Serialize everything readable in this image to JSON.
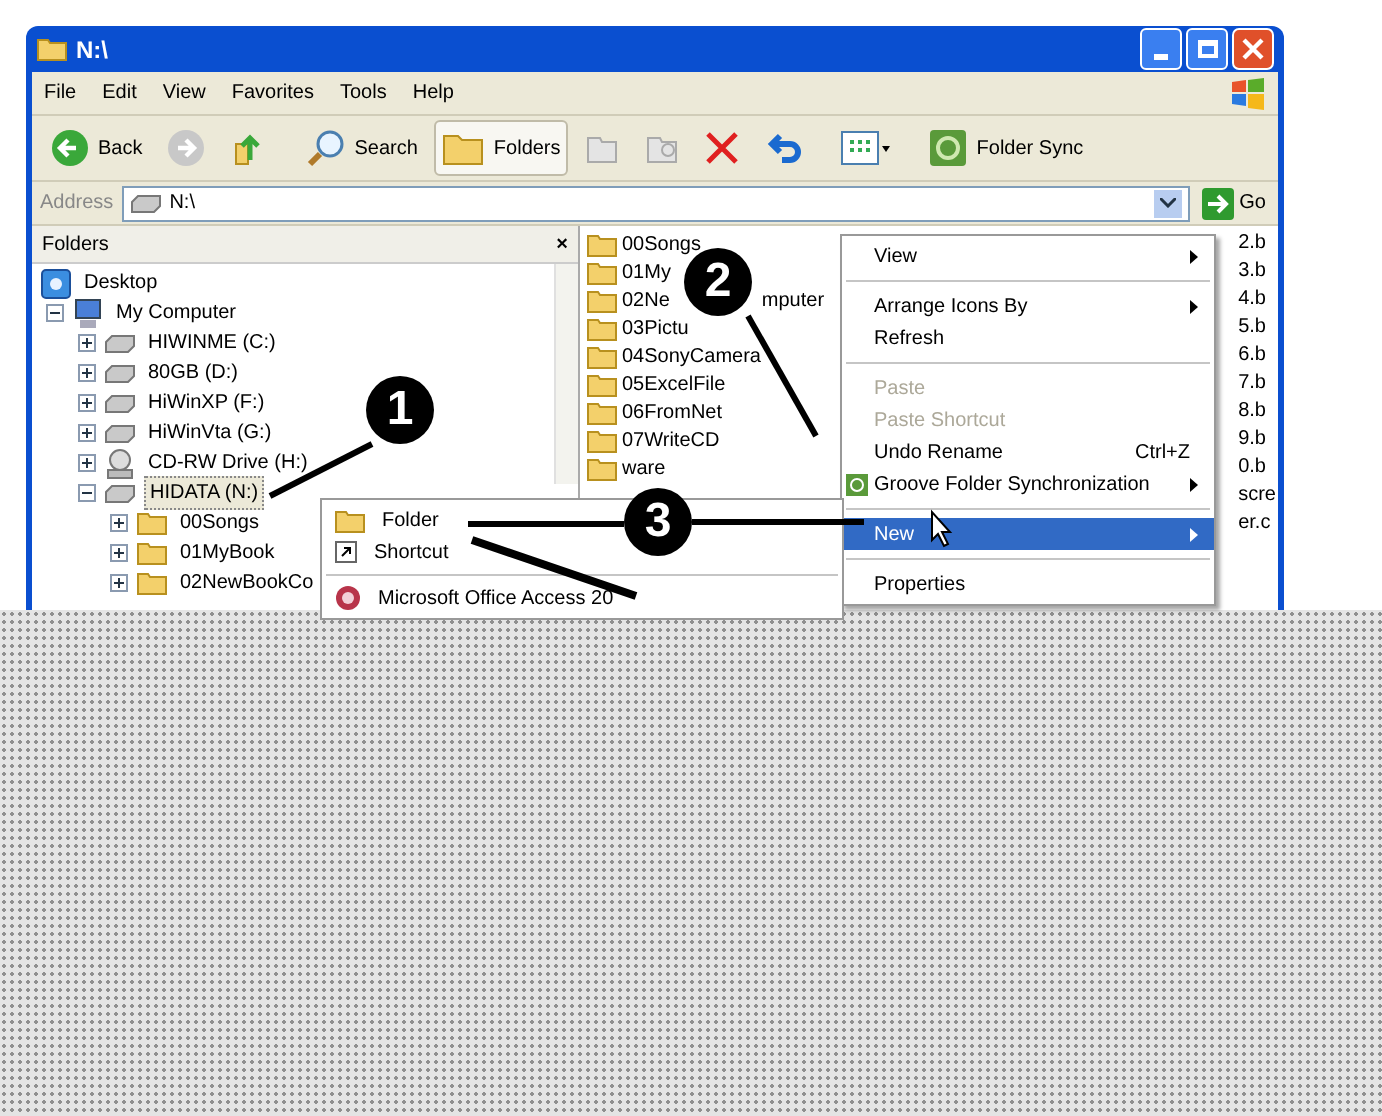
{
  "window": {
    "title": "N:\\"
  },
  "menu_bar": [
    "File",
    "Edit",
    "View",
    "Favorites",
    "Tools",
    "Help"
  ],
  "toolbar": [
    {
      "kind": "back",
      "label": "Back",
      "pressed": false
    },
    {
      "kind": "forward",
      "pressed": false
    },
    {
      "kind": "up",
      "pressed": false
    },
    {
      "kind": "search",
      "label": "Search",
      "pressed": false
    },
    {
      "kind": "folders",
      "label": "Folders",
      "pressed": true
    },
    {
      "kind": "move",
      "pressed": false
    },
    {
      "kind": "copy",
      "pressed": false
    },
    {
      "kind": "delete",
      "pressed": false
    },
    {
      "kind": "undo",
      "pressed": false
    },
    {
      "kind": "views",
      "pressed": false
    },
    {
      "kind": "sync",
      "label": "Folder Sync",
      "pressed": false
    }
  ],
  "address": {
    "label": "Address",
    "value": "N:\\",
    "go": "Go"
  },
  "folders_pane": {
    "title": "Folders",
    "close": "×",
    "tree": [
      {
        "kind": "desktop",
        "label": "Desktop",
        "selected": false,
        "children": [
          {
            "kind": "computer",
            "label": "My Computer",
            "expanded": true,
            "selected": false,
            "children": [
              {
                "kind": "drive",
                "label": "HIWINME (C:)",
                "expanded": false,
                "selected": false
              },
              {
                "kind": "drive",
                "label": "80GB (D:)",
                "expanded": false,
                "selected": false
              },
              {
                "kind": "drive",
                "label": "HiWinXP (F:)",
                "expanded": false,
                "selected": false
              },
              {
                "kind": "drive",
                "label": "HiWinVta (G:)",
                "expanded": false,
                "selected": false
              },
              {
                "kind": "cdrom",
                "label": "CD-RW Drive (H:)",
                "expanded": false,
                "selected": false
              },
              {
                "kind": "drive",
                "label": "HIDATA (N:)",
                "expanded": true,
                "selected": true,
                "children": [
                  {
                    "kind": "folder",
                    "label": "00Songs",
                    "expanded": false,
                    "selected": false
                  },
                  {
                    "kind": "folder",
                    "label": "01MyBook",
                    "expanded": false,
                    "selected": false
                  },
                  {
                    "kind": "folder",
                    "label": "02NewBookCo",
                    "expanded": false,
                    "selected": false
                  }
                ]
              }
            ]
          }
        ]
      }
    ]
  },
  "file_list": {
    "names": [
      {
        "label": "00Songs"
      },
      {
        "label": "01My"
      },
      {
        "label": "02Ne",
        "tail": "mputer"
      },
      {
        "label": "03Pictu"
      },
      {
        "label": "04SonyCamera"
      },
      {
        "label": "05ExcelFile"
      },
      {
        "label": "06FromNet"
      },
      {
        "label": "07WriteCD"
      },
      {
        "label": "ware"
      }
    ],
    "column_3": [
      "2.b",
      "3.b",
      "4.b",
      "5.b",
      "6.b",
      "7.b",
      "8.b",
      "9.b",
      "0.b",
      "scre",
      "er.c"
    ]
  },
  "context_menu": [
    {
      "kind": "item",
      "label": "View",
      "submenu": true,
      "disabled": false,
      "selected": false
    },
    {
      "kind": "separator"
    },
    {
      "kind": "item",
      "label": "Arrange Icons By",
      "submenu": true,
      "disabled": false,
      "selected": false
    },
    {
      "kind": "item",
      "label": "Refresh",
      "submenu": false,
      "disabled": false,
      "selected": false
    },
    {
      "kind": "separator"
    },
    {
      "kind": "item",
      "label": "Paste",
      "submenu": false,
      "disabled": true,
      "selected": false
    },
    {
      "kind": "item",
      "label": "Paste Shortcut",
      "submenu": false,
      "disabled": true,
      "selected": false
    },
    {
      "kind": "item",
      "label": "Undo Rename",
      "shortcut": "Ctrl+Z",
      "submenu": false,
      "disabled": false,
      "selected": false
    },
    {
      "kind": "sync",
      "label": "Groove Folder Synchronization",
      "submenu": true,
      "disabled": false,
      "selected": false
    },
    {
      "kind": "separator"
    },
    {
      "kind": "item",
      "label": "New",
      "submenu": true,
      "disabled": false,
      "selected": true
    },
    {
      "kind": "separator"
    },
    {
      "kind": "item",
      "label": "Properties",
      "submenu": false,
      "disabled": false,
      "selected": false
    }
  ],
  "submenu": [
    {
      "kind": "folder",
      "label": "Folder"
    },
    {
      "kind": "shortcut",
      "label": "Shortcut"
    },
    {
      "kind": "separator"
    },
    {
      "kind": "access",
      "label": "Microsoft Office Access 20"
    }
  ],
  "callouts": [
    {
      "number": "1"
    },
    {
      "number": "2"
    },
    {
      "number": "3"
    }
  ]
}
